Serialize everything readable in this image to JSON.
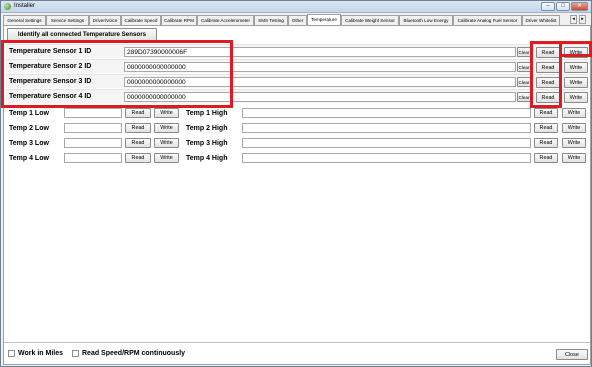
{
  "window": {
    "title": "Installer",
    "controls": {
      "minimize": "–",
      "maximize": "□",
      "close": "✕"
    }
  },
  "tabs": [
    "General Settings",
    "Service Settings",
    "Driver/Voice",
    "Calibrate Speed",
    "Calibrate RPM",
    "Calibrate Accelerometer",
    "SMS Testing",
    "Other",
    "Temperature",
    "Calibrate Weight Sensor",
    "Bluetooth Low Energy",
    "Calibrate Analog Fuel Sensor",
    "Driver Whitelist"
  ],
  "active_tab": "Temperature",
  "identify_button": "Identify all connected Temperature Sensors",
  "sensors": [
    {
      "label": "Temperature Sensor 1 ID",
      "value": "289D07390000006F",
      "clear": "Clear",
      "read": "Read",
      "write": "Write"
    },
    {
      "label": "Temperature Sensor 2 ID",
      "value": "0000000000000000",
      "clear": "Clear",
      "read": "Read",
      "write": "Write"
    },
    {
      "label": "Temperature Sensor 3 ID",
      "value": "0000000000000000",
      "clear": "Clear",
      "read": "Read",
      "write": "Write"
    },
    {
      "label": "Temperature Sensor 4 ID",
      "value": "0000000000000000",
      "clear": "Clear",
      "read": "Read",
      "write": "Write"
    }
  ],
  "low_limits": [
    {
      "label": "Temp 1 Low",
      "value": "",
      "read": "Read",
      "write": "Write"
    },
    {
      "label": "Temp 2 Low",
      "value": "",
      "read": "Read",
      "write": "Write"
    },
    {
      "label": "Temp 3 Low",
      "value": "",
      "read": "Read",
      "write": "Write"
    },
    {
      "label": "Temp 4 Low",
      "value": "",
      "read": "Read",
      "write": "Write"
    }
  ],
  "high_limits": [
    {
      "label": "Temp 1 High",
      "value": "",
      "read": "Read",
      "write": "Write"
    },
    {
      "label": "Temp 2 High",
      "value": "",
      "read": "Read",
      "write": "Write"
    },
    {
      "label": "Temp 3 High",
      "value": "",
      "read": "Read",
      "write": "Write"
    },
    {
      "label": "Temp 4 High",
      "value": "",
      "read": "Read",
      "write": "Write"
    }
  ],
  "footer": {
    "work_in_miles": "Work in Miles",
    "read_continuously": "Read Speed/RPM continuously",
    "close": "Close"
  },
  "colors": {
    "highlight": "#e01a22",
    "accent": "#3f8a2a"
  }
}
